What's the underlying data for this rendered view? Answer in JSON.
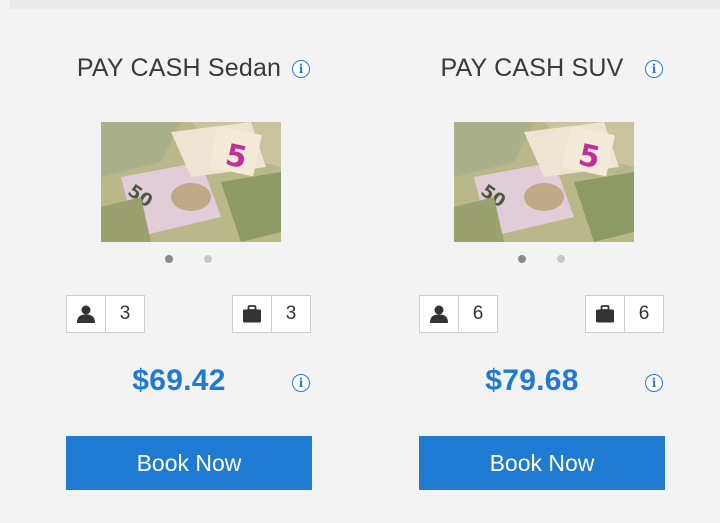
{
  "cards": [
    {
      "title": "PAY CASH Sedan",
      "passengers": "3",
      "luggage": "3",
      "price": "$69.42",
      "book_label": "Book Now"
    },
    {
      "title": "PAY CASH SUV",
      "passengers": "6",
      "luggage": "6",
      "price": "$79.68",
      "book_label": "Book Now"
    }
  ],
  "icons": {
    "info": "info-icon",
    "passengers": "user-icon",
    "luggage": "briefcase-icon"
  },
  "colors": {
    "accent": "#1f7ad1",
    "background": "#f3f3f3"
  }
}
